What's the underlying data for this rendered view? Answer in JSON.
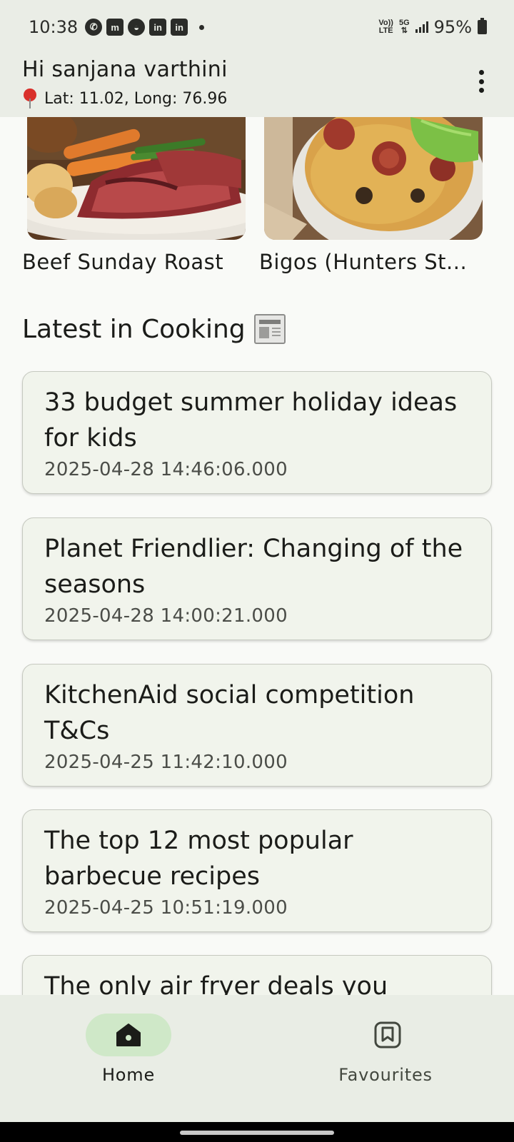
{
  "status_bar": {
    "time": "10:38",
    "network_top": "Vo))",
    "network_bottom": "LTE",
    "gen": "5G",
    "battery": "95%"
  },
  "header": {
    "greeting": "Hi sanjana varthini",
    "location": "Lat: 11.02, Long: 76.96"
  },
  "recipes": [
    {
      "name": "Beef Sunday Roast"
    },
    {
      "name": "Bigos (Hunters St..."
    }
  ],
  "section": {
    "title": "Latest in Cooking",
    "icon": "newspaper-icon"
  },
  "articles": [
    {
      "title": "33 budget summer holiday ideas for kids",
      "date": "2025-04-28 14:46:06.000"
    },
    {
      "title": "Planet Friendlier: Changing of the seasons",
      "date": "2025-04-28 14:00:21.000"
    },
    {
      "title": "KitchenAid social competition T&Cs",
      "date": "2025-04-25 11:42:10.000"
    },
    {
      "title": "The top 12 most popular barbecue recipes",
      "date": "2025-04-25 10:51:19.000"
    },
    {
      "title": "The only air fryer deals you should consider this April",
      "date": ""
    }
  ],
  "nav": {
    "home": "Home",
    "favourites": "Favourites",
    "accent": "#cfe8c8"
  }
}
